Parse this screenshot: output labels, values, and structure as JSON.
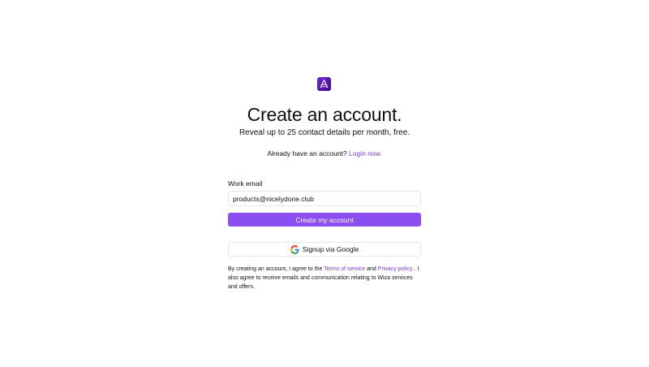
{
  "brand": {
    "accent_color": "#8b4ef0",
    "link_color": "#7c3aed",
    "logo_icon": "wiza-logo-icon"
  },
  "header": {
    "title": "Create an account.",
    "subtitle": "Reveal up to 25 contact details per month, free."
  },
  "login": {
    "prompt": "Already have an account?",
    "link_label": "Login now."
  },
  "form": {
    "email_label": "Work email",
    "email_value": "products@nicelydone.club",
    "submit_label": "Create my account",
    "google_label": "Signup via Google",
    "google_icon": "google-icon"
  },
  "legal": {
    "prefix": "By creating an account, I agree to the",
    "terms_link": "Terms of service",
    "and": "and",
    "privacy_link": "Privacy policy",
    "suffix": ". I also agree to receive emails and communication relating to Wiza services and offers."
  }
}
